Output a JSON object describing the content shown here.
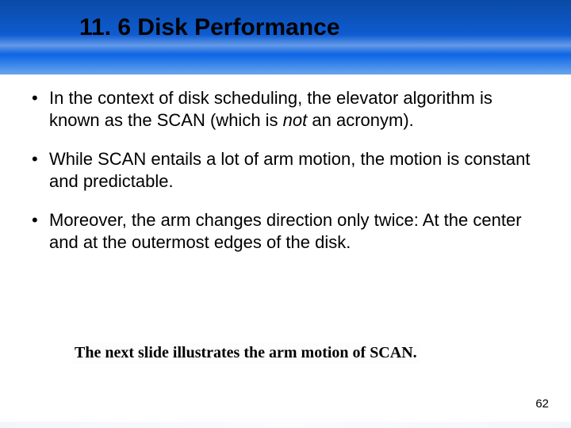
{
  "header": {
    "title": "11. 6 Disk Performance"
  },
  "bullets": [
    {
      "pre": "In the context of disk scheduling, the elevator algorithm is known as the SCAN (which is ",
      "ital": "not",
      "post": " an acronym)."
    },
    {
      "pre": "While SCAN entails a lot of arm motion, the motion is constant and predictable.",
      "ital": "",
      "post": ""
    },
    {
      "pre": "Moreover, the arm changes direction only twice: At the center and at the outermost edges of the disk.",
      "ital": "",
      "post": ""
    }
  ],
  "footer": {
    "note": "The next slide illustrates the arm motion of SCAN."
  },
  "page": {
    "number": "62"
  }
}
